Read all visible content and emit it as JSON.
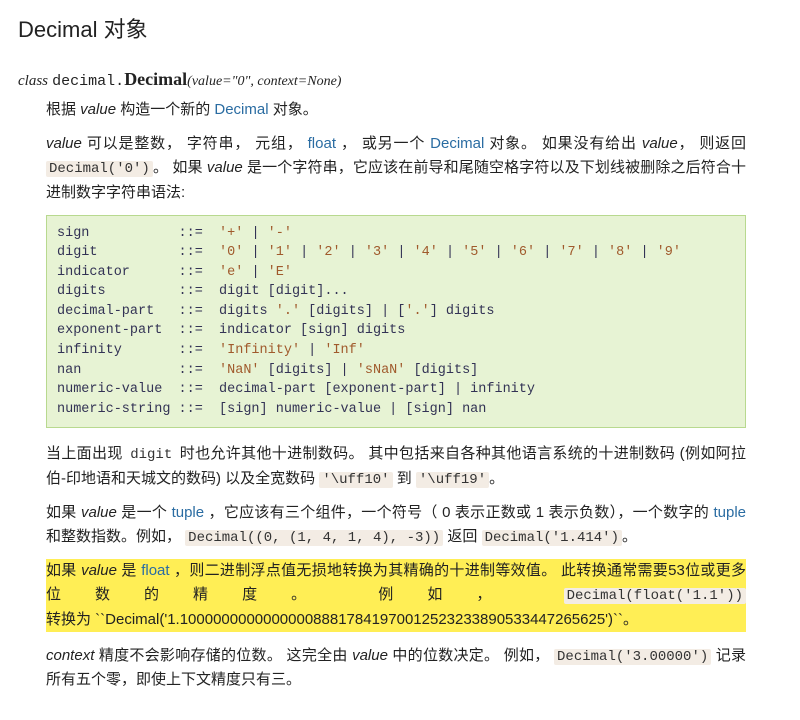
{
  "heading": "Decimal 对象",
  "sig": {
    "kw": "class",
    "module": "decimal.",
    "clsname": "Decimal",
    "params": "(value=\"0\", context=None)"
  },
  "p1a": "根据 ",
  "p1b_value": "value",
  "p1c": " 构造一个新的 ",
  "p1d_decimal": "Decimal",
  "p1e": " 对象。",
  "p2a_value": "value",
  "p2b": " 可以是整数， 字符串， 元组， ",
  "p2c_float": "float",
  "p2d": " ， 或另一个 ",
  "p2e_decimal": "Decimal",
  "p2f": " 对象。  如果没有给出 ",
  "p2g_value": "value",
  "p2h": "， 则返回 ",
  "p2i_code": "Decimal('0')",
  "p2j": "。 如果 ",
  "p2k_value": "value",
  "p2l": " 是一个字符串，它应该在前导和尾随空格字符以及下划线被删除之后符合十进制数字字符串语法:",
  "grammar_lines": [
    {
      "lhs": "sign          ",
      "op": " ::=  ",
      "rhs": [
        {
          "s": "'+'"
        },
        {
          "t": " | "
        },
        {
          "s": "'-'"
        }
      ]
    },
    {
      "lhs": "digit         ",
      "op": " ::=  ",
      "rhs": [
        {
          "s": "'0'"
        },
        {
          "t": " | "
        },
        {
          "s": "'1'"
        },
        {
          "t": " | "
        },
        {
          "s": "'2'"
        },
        {
          "t": " | "
        },
        {
          "s": "'3'"
        },
        {
          "t": " | "
        },
        {
          "s": "'4'"
        },
        {
          "t": " | "
        },
        {
          "s": "'5'"
        },
        {
          "t": " | "
        },
        {
          "s": "'6'"
        },
        {
          "t": " | "
        },
        {
          "s": "'7'"
        },
        {
          "t": " | "
        },
        {
          "s": "'8'"
        },
        {
          "t": " | "
        },
        {
          "s": "'9'"
        }
      ]
    },
    {
      "lhs": "indicator     ",
      "op": " ::=  ",
      "rhs": [
        {
          "s": "'e'"
        },
        {
          "t": " | "
        },
        {
          "s": "'E'"
        }
      ]
    },
    {
      "lhs": "digits        ",
      "op": " ::=  ",
      "rhs": [
        {
          "t": "digit [digit]..."
        }
      ]
    },
    {
      "lhs": "decimal-part  ",
      "op": " ::=  ",
      "rhs": [
        {
          "t": "digits "
        },
        {
          "s": "'.'"
        },
        {
          "t": " [digits] | ["
        },
        {
          "s": "'.'"
        },
        {
          "t": "] digits"
        }
      ]
    },
    {
      "lhs": "exponent-part ",
      "op": " ::=  ",
      "rhs": [
        {
          "t": "indicator [sign] digits"
        }
      ]
    },
    {
      "lhs": "infinity      ",
      "op": " ::=  ",
      "rhs": [
        {
          "s": "'Infinity'"
        },
        {
          "t": " | "
        },
        {
          "s": "'Inf'"
        }
      ]
    },
    {
      "lhs": "nan           ",
      "op": " ::=  ",
      "rhs": [
        {
          "s": "'NaN'"
        },
        {
          "t": " [digits] | "
        },
        {
          "s": "'sNaN'"
        },
        {
          "t": " [digits]"
        }
      ]
    },
    {
      "lhs": "numeric-value ",
      "op": " ::=  ",
      "rhs": [
        {
          "t": "decimal-part [exponent-part] | infinity"
        }
      ]
    },
    {
      "lhs": "numeric-string",
      "op": " ::=  ",
      "rhs": [
        {
          "t": "[sign] numeric-value | [sign] nan"
        }
      ]
    }
  ],
  "p3a": "当上面出现 ",
  "p3b_digit": "digit",
  "p3c": " 时也允许其他十进制数码。 其中包括来自各种其他语言系统的十进制数码 (例如阿拉伯-印地语和天城文的数码) 以及全宽数码 ",
  "p3d_code1": "'\\uff10'",
  "p3e": " 到 ",
  "p3f_code2": "'\\uff19'",
  "p3g": "。",
  "p4a": "如果 ",
  "p4b_value": "value",
  "p4c": " 是一个 ",
  "p4d_tuple": "tuple",
  "p4e": " ，它应该有三个组件，一个符号（ 0 表示正数或 1 表示负数），一个数字的 ",
  "p4f_tuple2": "tuple",
  "p4g": " 和整数指数。例如， ",
  "p4h_code1": "Decimal((0, (1, 4, 1, 4), -3))",
  "p4i": " 返回 ",
  "p4j_code2": "Decimal('1.414')",
  "p4k": "。",
  "p5a": "如果 ",
  "p5b_value": "value",
  "p5c": " 是 ",
  "p5d_float": "float",
  "p5e": " ，则二进制浮点值无损地转换为其精确的十进制等效值。 此转换通常需要53位或更多位数的精度。 例如， ",
  "p5f_code": "Decimal(float('1.1'))",
  "p5g": " 转换为 ``Decimal('1.100000000000000088817841970012523233890533447265625')``。",
  "p6a_context": "context",
  "p6b": " 精度不会影响存储的位数。 这完全由 ",
  "p6c_value": "value",
  "p6d": " 中的位数决定。 例如， ",
  "p6e_code": "Decimal('3.00000')",
  "p6f": " 记录所有五个零，即使上下文精度只有三。"
}
